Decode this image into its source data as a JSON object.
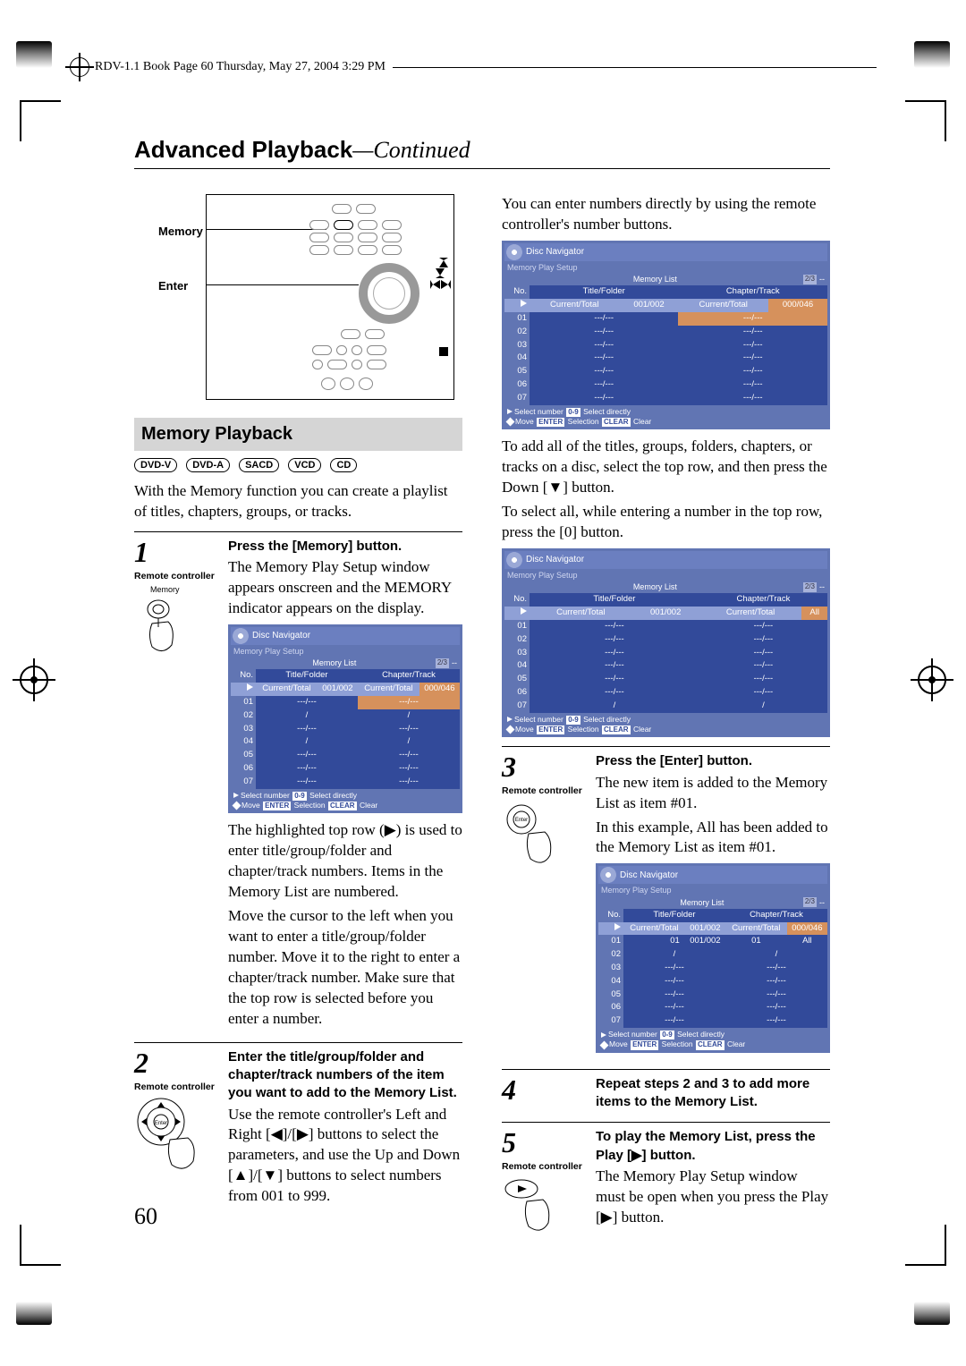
{
  "meta": {
    "header": "RDV-1.1 Book  Page 60  Thursday, May 27, 2004   3:29 PM",
    "title_bold": "Advanced Playback",
    "title_cont": "—Continued",
    "page_number": "60"
  },
  "diagram": {
    "label_memory": "Memory",
    "label_enter": "Enter"
  },
  "section_heading": "Memory Playback",
  "badges": [
    "DVD-V",
    "DVD-A",
    "SACD",
    "VCD",
    "CD"
  ],
  "intro": "With the Memory function you can create a playlist of titles, chapters, groups, or tracks.",
  "right_intro": "You can enter numbers directly by using the remote controller's number buttons.",
  "right_text_add_all": "To add all of the titles, groups, folders, chapters, or tracks on a disc, select the top row, and then press the Down [▼] button.",
  "right_text_select_all": "To select all, while entering a number in the top row, press the [0] button.",
  "rc_label": "Remote controller",
  "memory_key_label": "Memory",
  "steps": {
    "s1": {
      "num": "1",
      "title": "Press the [Memory] button.",
      "body1": "The Memory Play Setup window appears onscreen and the MEMORY indicator appears on the display.",
      "body2": "The highlighted top row (▶) is used to enter title/group/folder and chapter/track numbers. Items in the Memory List are numbered.",
      "body3": "Move the cursor to the left when you want to enter a title/group/folder number. Move it to the right to enter a chapter/track number. Make sure that the top row is selected before you enter a number."
    },
    "s2": {
      "num": "2",
      "title": "Enter the title/group/folder and chapter/track numbers of the item you want to add to the Memory List.",
      "body": "Use the remote controller's Left and Right [◀]/[▶] buttons to select the parameters, and use the Up and Down [▲]/[▼] buttons to select numbers from 001 to 999."
    },
    "s3": {
      "num": "3",
      "title": "Press the [Enter] button.",
      "body1": "The new item is added to the Memory List as item #01.",
      "body2": "In this example, All has been added to the Memory List as item #01."
    },
    "s4": {
      "num": "4",
      "title": "Repeat steps 2 and 3 to add more items to the Memory List."
    },
    "s5": {
      "num": "5",
      "title": "To play the Memory List, press the Play [▶] button.",
      "body": "The Memory Play Setup window must be open when you press the Play [▶] button."
    }
  },
  "nav": {
    "title": "Disc Navigator",
    "sub": "Memory Play Setup",
    "memory_list": "Memory List",
    "pager": "--",
    "col1": "No.",
    "col2": "Title/Folder",
    "col3": "Chapter/Track",
    "ct_label": "Current/Total",
    "panel1": {
      "row0_b": "001/002",
      "row0_d": "000/046",
      "rows": [
        "01",
        "02",
        "03",
        "04",
        "05",
        "06",
        "07"
      ]
    },
    "panel2": {
      "row0_b": "001/002",
      "row0_c": "Current/Total",
      "row0_d": "All",
      "rows": [
        "01",
        "02",
        "03",
        "04",
        "05",
        "06",
        "07"
      ]
    },
    "panel3": {
      "row0_b": "001/002",
      "row0_c": "Current/Total",
      "row0_d": "000/046",
      "row1_a": "01",
      "row1_b": "001/002",
      "row1_c": "01",
      "row1_d": "All",
      "rows": [
        "02",
        "03",
        "04",
        "05",
        "06",
        "07"
      ]
    },
    "cell_dash": "---/---",
    "cell_slash": "/",
    "foot1_a": "Select number",
    "foot1_b": "0-9",
    "foot1_c": "Select directly",
    "foot2_a": "Move",
    "foot2_b": "ENTER",
    "foot2_c": "Selection",
    "foot2_d": "CLEAR",
    "foot2_e": "Clear"
  }
}
